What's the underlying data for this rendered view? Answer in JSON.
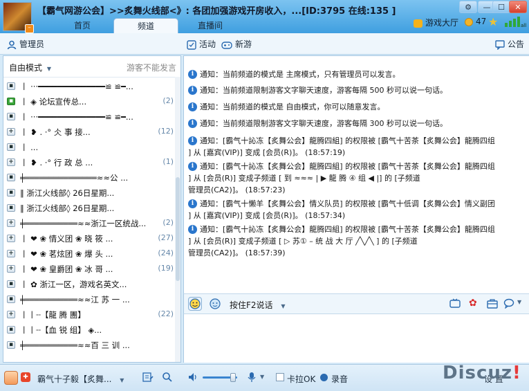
{
  "window": {
    "title": "【霸气网游公会】>>炙舞火线部<》: 各团加强游戏开房收入，...[ID:3795 在线:135 ]",
    "buttons": {
      "settings": "⚙",
      "minimize": "—",
      "maximize": "☐",
      "close": "✕"
    }
  },
  "tabs": [
    {
      "label": "首页"
    },
    {
      "label": "频道"
    },
    {
      "label": "直播间"
    }
  ],
  "titlebar_right": {
    "game_hall": "游戏大厅",
    "coins": "47"
  },
  "toolbar": {
    "admin": "管理员",
    "activity": "活动",
    "new_game": "新游",
    "notice": "公告"
  },
  "left_panel": {
    "mode": "自由模式",
    "guest_notice": "游客不能发言",
    "items": [
      {
        "icon": "lock",
        "name": "丨     ···━━━━━━━━━━━━━━≌ ≌━...",
        "count": ""
      },
      {
        "icon": "green",
        "name": "丨               ◈  论坛宣传总...",
        "count": "(2)"
      },
      {
        "icon": "lock",
        "name": "丨     ···━━━━━━━━━━━━━━≌ ≌━...",
        "count": ""
      },
      {
        "icon": "plus",
        "name": "丨           ❥ . ·°     仌 事 接...",
        "count": "(12)"
      },
      {
        "icon": "lock",
        "name": "丨                               ...",
        "count": ""
      },
      {
        "icon": "plus",
        "name": "丨           ❥ . ·°     行 政 总 ...",
        "count": "(1)"
      },
      {
        "icon": "lock",
        "name": "╪═══════════════≈≈公   ...",
        "count": ""
      },
      {
        "icon": "lock",
        "name": "‖   浙江火线部◊        26日星期...",
        "count": ""
      },
      {
        "icon": "lock",
        "name": "‖   浙江火线部◊        26日星期...",
        "count": ""
      },
      {
        "icon": "plus",
        "name": "╪═══════════≈≈浙江一区统战...",
        "count": "(2)"
      },
      {
        "icon": "plus",
        "name": "丨     ❤   ❀ 情义团   ❀ 晓 筱 ...",
        "count": "(27)"
      },
      {
        "icon": "plus",
        "name": "丨     ❤   ❀ 茗炫团   ❀ 爆 头 ...",
        "count": "(24)"
      },
      {
        "icon": "plus",
        "name": "丨     ❤   ❀ 皇爵团   ❀ 冰 哥 ...",
        "count": "(19)"
      },
      {
        "icon": "lock",
        "name": "丨     ✿    浙江一区，游戏名英文...",
        "count": ""
      },
      {
        "icon": "lock",
        "name": "╪═══════════≈≈江  苏   一 ...",
        "count": ""
      },
      {
        "icon": "plus",
        "name": "丨丨┈【龍    腾    團】 ",
        "count": "(22)"
      },
      {
        "icon": "lock",
        "name": "丨丨┈【血   锐   组】        ◈...",
        "count": ""
      },
      {
        "icon": "lock",
        "name": "╪═══════════≈≈百  三   训 ...",
        "count": ""
      }
    ]
  },
  "messages": [
    {
      "line1": "通知：当前频道的模式是 主席模式，只有管理员可以发言。",
      "line2": "",
      "line3": ""
    },
    {
      "line1": "通知：当前频道限制游客文字聊天速度，游客每隔 500 秒可以说一句话。",
      "line2": "",
      "line3": ""
    },
    {
      "line1": "通知：当前频道的模式是 自由模式，你可以随意发言。",
      "line2": "",
      "line3": ""
    },
    {
      "line1": "通知：当前频道限制游客文字聊天速度，游客每隔 300 秒可以说一句话。",
      "line2": "",
      "line3": ""
    },
    {
      "line1": "通知：[霸气十訫冻【炙舞公会】龍腾四組] 的权限被 [霸气十苦茶【炙舞公会】龍腾四组",
      "line2": "] 从 [嘉宾(VIP)] 变成 [会员(R)]。 (18:57:19)",
      "line3": ""
    },
    {
      "line1": "通知：[霸气十訫冻【炙舞公会】龍腾四組] 的权限被 [霸气十苦茶【炙舞公会】龍腾四组",
      "line2": "] 从 [会员(R)] 变成子频道 [   到  ≈≈≈   |     ▶ 龍 腾 ④ 组 ◀     |] 的 [子频道",
      "line3": "管理员(CA2)]。 (18:57:23)"
    },
    {
      "line1": "通知：[霸气十懒羊【炙舞公会】情义队员] 的权限被 [霸气十低调【炙舞公会】情义副团",
      "line2": "] 从 [嘉宾(VIP)] 变成 [会员(R)]。 (18:57:34)",
      "line3": ""
    },
    {
      "line1": "通知：[霸气十訫冻【炙舞公会】龍腾四組] 的权限被 [霸气十苦茶【炙舞公会】龍腾四组",
      "line2": "] 从 [会员(R)] 变成子频道 [   ▷  苏① –     统 战 大 厅     ╱╲╱╲     ] 的 [子频道",
      "line3": "管理员(CA2)]。 (18:57:39)"
    }
  ],
  "input": {
    "talk_mode": "按住F2说话"
  },
  "bottom": {
    "username": "霸气十子毅【炙舞...",
    "karaoke": "卡拉OK",
    "record": "录音",
    "settings": "设 置"
  },
  "watermark": {
    "text": "Discuz",
    "bang": "!"
  }
}
